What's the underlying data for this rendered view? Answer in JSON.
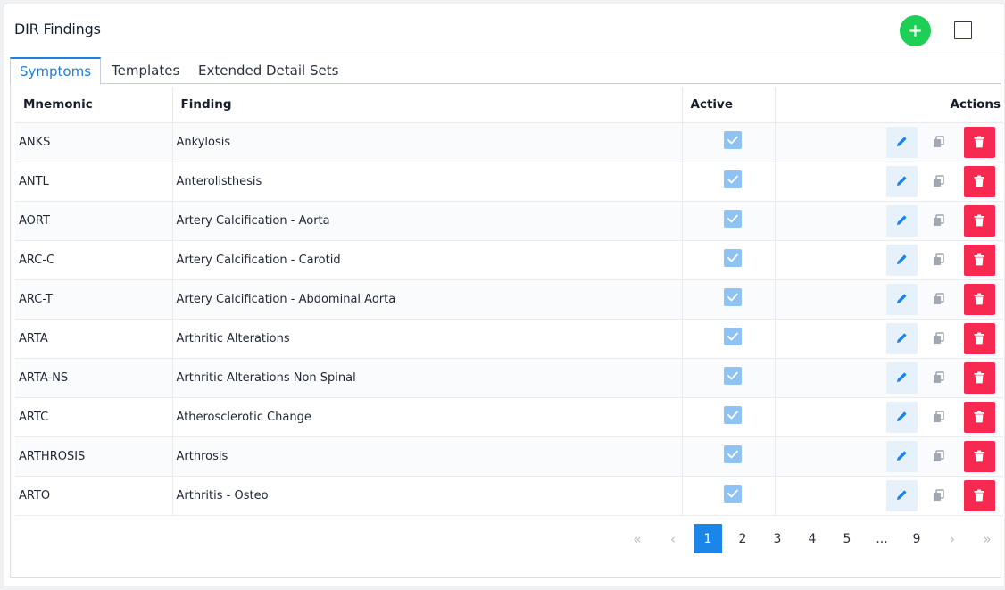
{
  "header": {
    "title": "DIR Findings"
  },
  "tabs": [
    {
      "label": "Symptoms",
      "active": true
    },
    {
      "label": "Templates",
      "active": false
    },
    {
      "label": "Extended Detail Sets",
      "active": false
    }
  ],
  "table": {
    "columns": {
      "mnemonic": "Mnemonic",
      "finding": "Finding",
      "active": "Active",
      "actions": "Actions"
    },
    "rows": [
      {
        "mnemonic": "ANKS",
        "finding": "Ankylosis",
        "active": true
      },
      {
        "mnemonic": "ANTL",
        "finding": "Anterolisthesis",
        "active": true
      },
      {
        "mnemonic": "AORT",
        "finding": "Artery Calcification - Aorta",
        "active": true
      },
      {
        "mnemonic": "ARC-C",
        "finding": "Artery Calcification - Carotid",
        "active": true
      },
      {
        "mnemonic": "ARC-T",
        "finding": "Artery Calcification - Abdominal Aorta",
        "active": true
      },
      {
        "mnemonic": "ARTA",
        "finding": "Arthritic Alterations",
        "active": true
      },
      {
        "mnemonic": "ARTA-NS",
        "finding": "Arthritic Alterations Non Spinal",
        "active": true
      },
      {
        "mnemonic": "ARTC",
        "finding": "Atherosclerotic Change",
        "active": true
      },
      {
        "mnemonic": "ARTHROSIS",
        "finding": "Arthrosis",
        "active": true
      },
      {
        "mnemonic": "ARTO",
        "finding": "Arthritis - Osteo",
        "active": true
      }
    ]
  },
  "pagination": {
    "first": "«",
    "prev": "‹",
    "pages": [
      "1",
      "2",
      "3",
      "4",
      "5",
      "...",
      "9"
    ],
    "current": "1",
    "next": "›",
    "last": "»"
  },
  "colors": {
    "accent": "#1b85ea",
    "add": "#1ecf55",
    "delete": "#f72951",
    "edit_bg": "#e6f1fc",
    "checkbox": "#8fc3f3"
  },
  "icons": {
    "add": "plus-icon",
    "maximize": "square-icon",
    "edit": "pencil-icon",
    "copy": "copy-icon",
    "delete": "trash-icon",
    "check": "check-icon"
  }
}
